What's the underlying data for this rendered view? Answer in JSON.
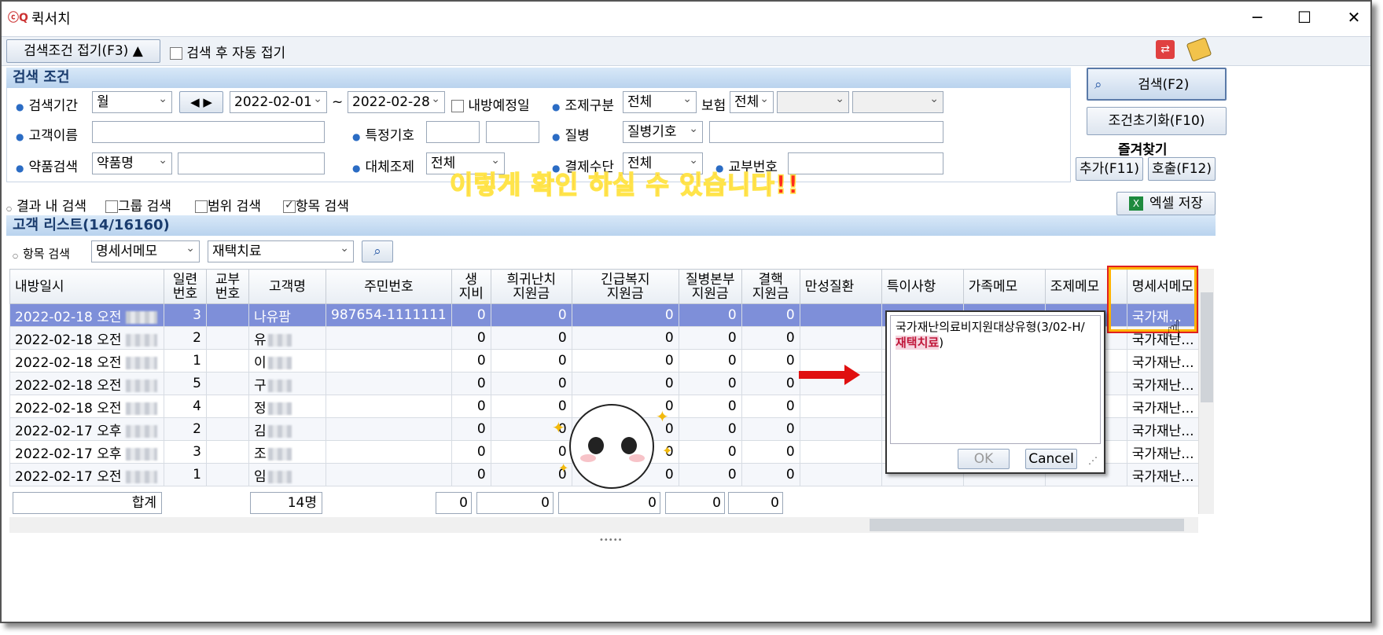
{
  "window": {
    "title": "퀵서치",
    "minimize": "─",
    "maximize": "☐",
    "close": "✕"
  },
  "toolbar": {
    "collapse_label": "검색조건 접기(F3) ▲",
    "auto_collapse_label": "검색 후 자동 접기",
    "auto_collapse_checked": false
  },
  "search_panel": {
    "header": "검색 조건",
    "period_label": "검색기간",
    "period_unit": "월",
    "date_from": "2022-02-01",
    "date_sep": "~",
    "date_to": "2022-02-28",
    "visit_scheduled_label": "내방예정일",
    "dispense_type_label": "조제구분",
    "dispense_type_value": "전체",
    "insurance_label": "보험",
    "insurance_value": "전체",
    "customer_name_label": "고객이름",
    "special_code_label": "특정기호",
    "disease_label": "질병",
    "disease_value": "질병기호",
    "drug_search_label": "약품검색",
    "drug_search_value": "약품명",
    "substitute_label": "대체조제",
    "substitute_value": "전체",
    "payment_label": "결제수단",
    "payment_value": "전체",
    "issue_no_label": "교부번호"
  },
  "side_buttons": {
    "search": "검색(F2)",
    "reset": "조건초기화(F10)",
    "favorites": "즐겨찾기",
    "add": "추가(F11)",
    "load": "호출(F12)"
  },
  "options": {
    "result_search": "결과 내 검색",
    "group_search": "그룹 검색",
    "range_search": "범위 검색",
    "item_search": "항목 검색",
    "item_search_checked": true,
    "excel_save": "엑셀 저장"
  },
  "banner": "이렇게 확인 하실 수 있습니다!!",
  "list": {
    "header": "고객 리스트(14/16160)",
    "item_search_label": "항목 검색",
    "item_field": "명세서메모",
    "item_value": "재택치료",
    "columns": [
      "내방일시",
      "일련\n번호",
      "교부\n번호",
      "고객명",
      "주민번호",
      "생\n지비",
      "희귀난치\n지원금",
      "긴급복지\n지원금",
      "질병본부\n지원금",
      "결핵\n지원금",
      "만성질환",
      "특이사항",
      "가족메모",
      "조제메모",
      "명세서메모"
    ],
    "rows": [
      {
        "date": "2022-02-18 오전",
        "seq": "3",
        "issue": "",
        "name": "나유팜",
        "rrn": "987654-1111111",
        "v1": "0",
        "v2": "0",
        "v3": "0",
        "v4": "0",
        "v5": "0",
        "memo": "국가재..."
      },
      {
        "date": "2022-02-18 오전",
        "seq": "2",
        "issue": "",
        "name": "유",
        "rrn": "",
        "v1": "0",
        "v2": "0",
        "v3": "0",
        "v4": "0",
        "v5": "0",
        "memo": "국가재난..."
      },
      {
        "date": "2022-02-18 오전",
        "seq": "1",
        "issue": "",
        "name": "이",
        "rrn": "",
        "v1": "0",
        "v2": "0",
        "v3": "0",
        "v4": "0",
        "v5": "0",
        "memo": "국가재난..."
      },
      {
        "date": "2022-02-18 오전",
        "seq": "5",
        "issue": "",
        "name": "구",
        "rrn": "",
        "v1": "0",
        "v2": "0",
        "v3": "0",
        "v4": "0",
        "v5": "0",
        "memo": "국가재난..."
      },
      {
        "date": "2022-02-18 오전",
        "seq": "4",
        "issue": "",
        "name": "정",
        "rrn": "",
        "v1": "0",
        "v2": "0",
        "v3": "0",
        "v4": "0",
        "v5": "0",
        "memo": "국가재난..."
      },
      {
        "date": "2022-02-17 오후",
        "seq": "2",
        "issue": "",
        "name": "김",
        "rrn": "",
        "v1": "0",
        "v2": "0",
        "v3": "0",
        "v4": "0",
        "v5": "0",
        "memo": "국가재난..."
      },
      {
        "date": "2022-02-17 오후",
        "seq": "3",
        "issue": "",
        "name": "조",
        "rrn": "",
        "v1": "0",
        "v2": "0",
        "v3": "0",
        "v4": "0",
        "v5": "0",
        "memo": "국가재난..."
      },
      {
        "date": "2022-02-17 오전",
        "seq": "1",
        "issue": "",
        "name": "임",
        "rrn": "",
        "v1": "0",
        "v2": "0",
        "v3": "0",
        "v4": "0",
        "v5": "0",
        "memo": "국가재난..."
      }
    ],
    "totals": {
      "label": "합계",
      "count": "14명",
      "v1": "0",
      "v2": "0",
      "v3": "0",
      "v4": "0",
      "v5": "0"
    }
  },
  "popup": {
    "text_line1": "국가재난의료비지원대상유형(3/02-H/",
    "text_highlight": "재택치료",
    "text_tail": ")",
    "ok": "OK",
    "cancel": "Cancel"
  }
}
